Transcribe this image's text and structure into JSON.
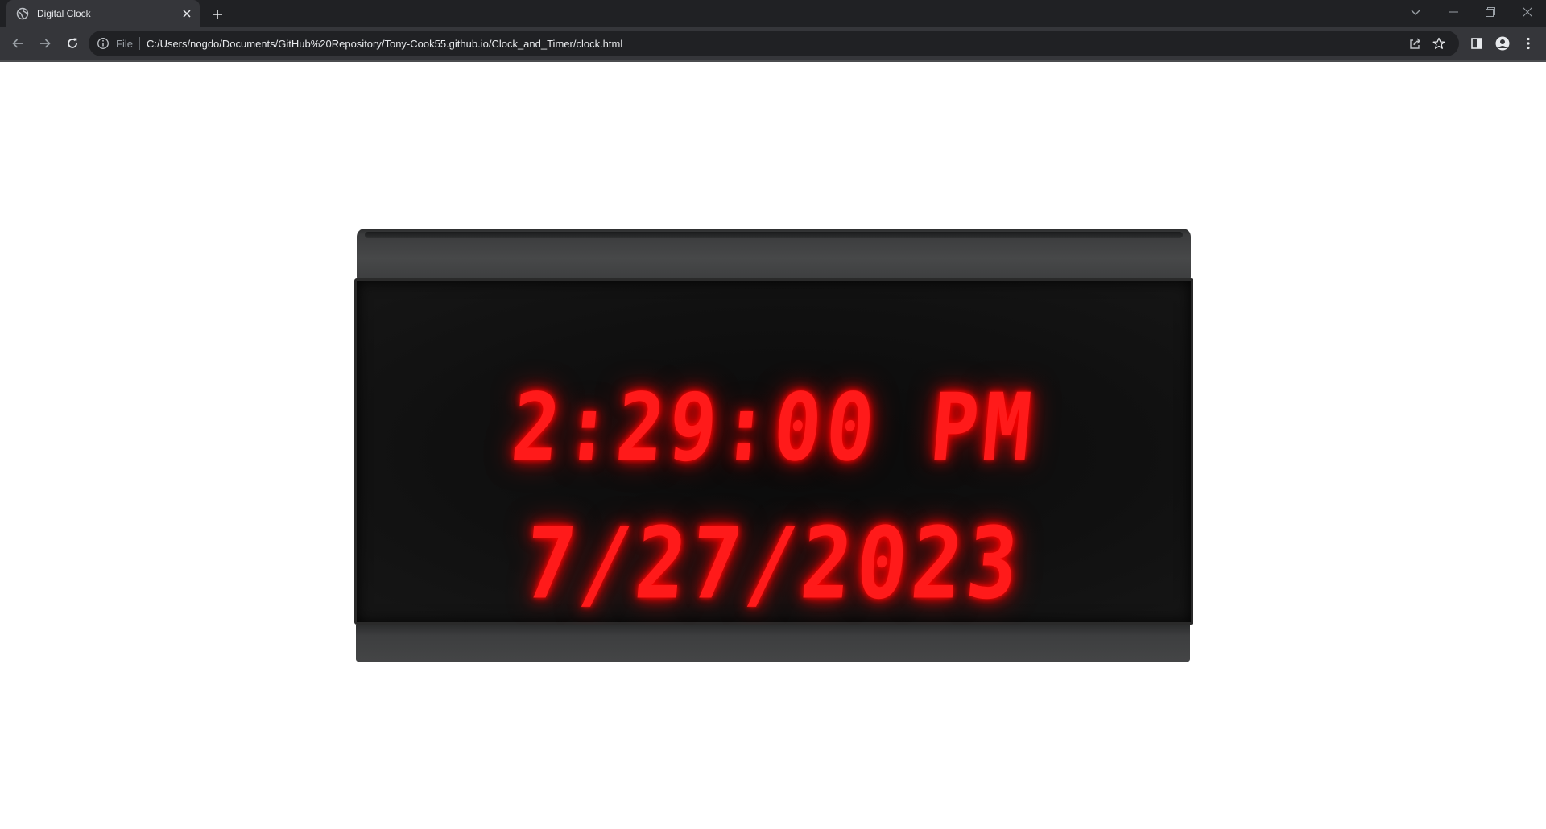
{
  "browser": {
    "tab_title": "Digital Clock",
    "url_scheme_label": "File",
    "url": "C:/Users/nogdo/Documents/GitHub%20Repository/Tony-Cook55.github.io/Clock_and_Timer/clock.html"
  },
  "clock": {
    "time": "2:29:00 PM",
    "date": "7/27/2023",
    "display_color": "#ff1a1a"
  },
  "icons": [
    "globe-icon",
    "close-icon",
    "plus-icon",
    "chevron-down-icon",
    "minimize-icon",
    "restore-icon",
    "window-close-icon",
    "back-arrow-icon",
    "forward-arrow-icon",
    "reload-icon",
    "info-icon",
    "share-icon",
    "star-icon",
    "side-panel-icon",
    "profile-icon",
    "kebab-menu-icon"
  ]
}
